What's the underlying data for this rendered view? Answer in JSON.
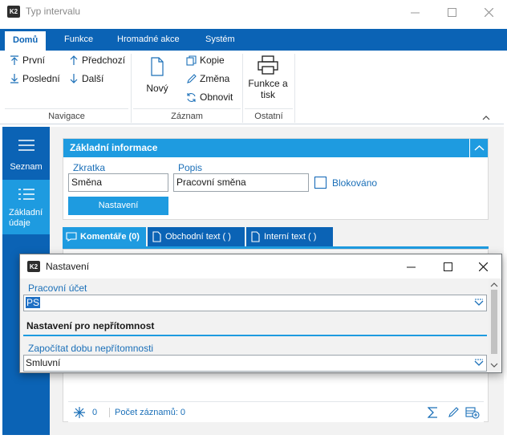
{
  "window": {
    "title": "Typ intervalu",
    "logo": "K2"
  },
  "ribbon": {
    "tabs": [
      "Domů",
      "Funkce",
      "Hromadné akce",
      "Systém"
    ],
    "navigace": {
      "first": "První",
      "last": "Poslední",
      "prev": "Předchozí",
      "next": "Další",
      "label": "Navigace"
    },
    "zaznam": {
      "new": "Nový",
      "copy": "Kopie",
      "change": "Změna",
      "refresh": "Obnovit",
      "label": "Záznam"
    },
    "ostatni": {
      "print_line1": "Funkce a",
      "print_line2": "tisk",
      "label": "Ostatní"
    }
  },
  "sidenav": {
    "items": [
      {
        "label": "Seznam"
      },
      {
        "label_line1": "Základní",
        "label_line2": "údaje"
      }
    ]
  },
  "basic_info": {
    "title": "Základní informace",
    "zkratka_label": "Zkratka",
    "zkratka_value": "Směna",
    "popis_label": "Popis",
    "popis_value": "Pracovní směna",
    "blokovano_label": "Blokováno",
    "nastaveni_button": "Nastavení"
  },
  "subtabs": [
    "Komentáře (0)",
    "Obchodní text ( )",
    "Interní text ( )"
  ],
  "status": {
    "count": "0",
    "records": "Počet záznamů: 0"
  },
  "dialog": {
    "title": "Nastavení",
    "logo": "K2",
    "pracovni_ucet_label": "Pracovní účet",
    "pracovni_ucet_value": "PS",
    "section_title": "Nastavení pro nepřítomnost",
    "zapocitat_label": "Započítat dobu nepřítomnosti",
    "zapocitat_value": "Smluvní"
  },
  "colors": {
    "ribbon_blue": "#0b63b5",
    "accent_blue": "#1e9be0",
    "label_blue": "#1a6fb8"
  }
}
